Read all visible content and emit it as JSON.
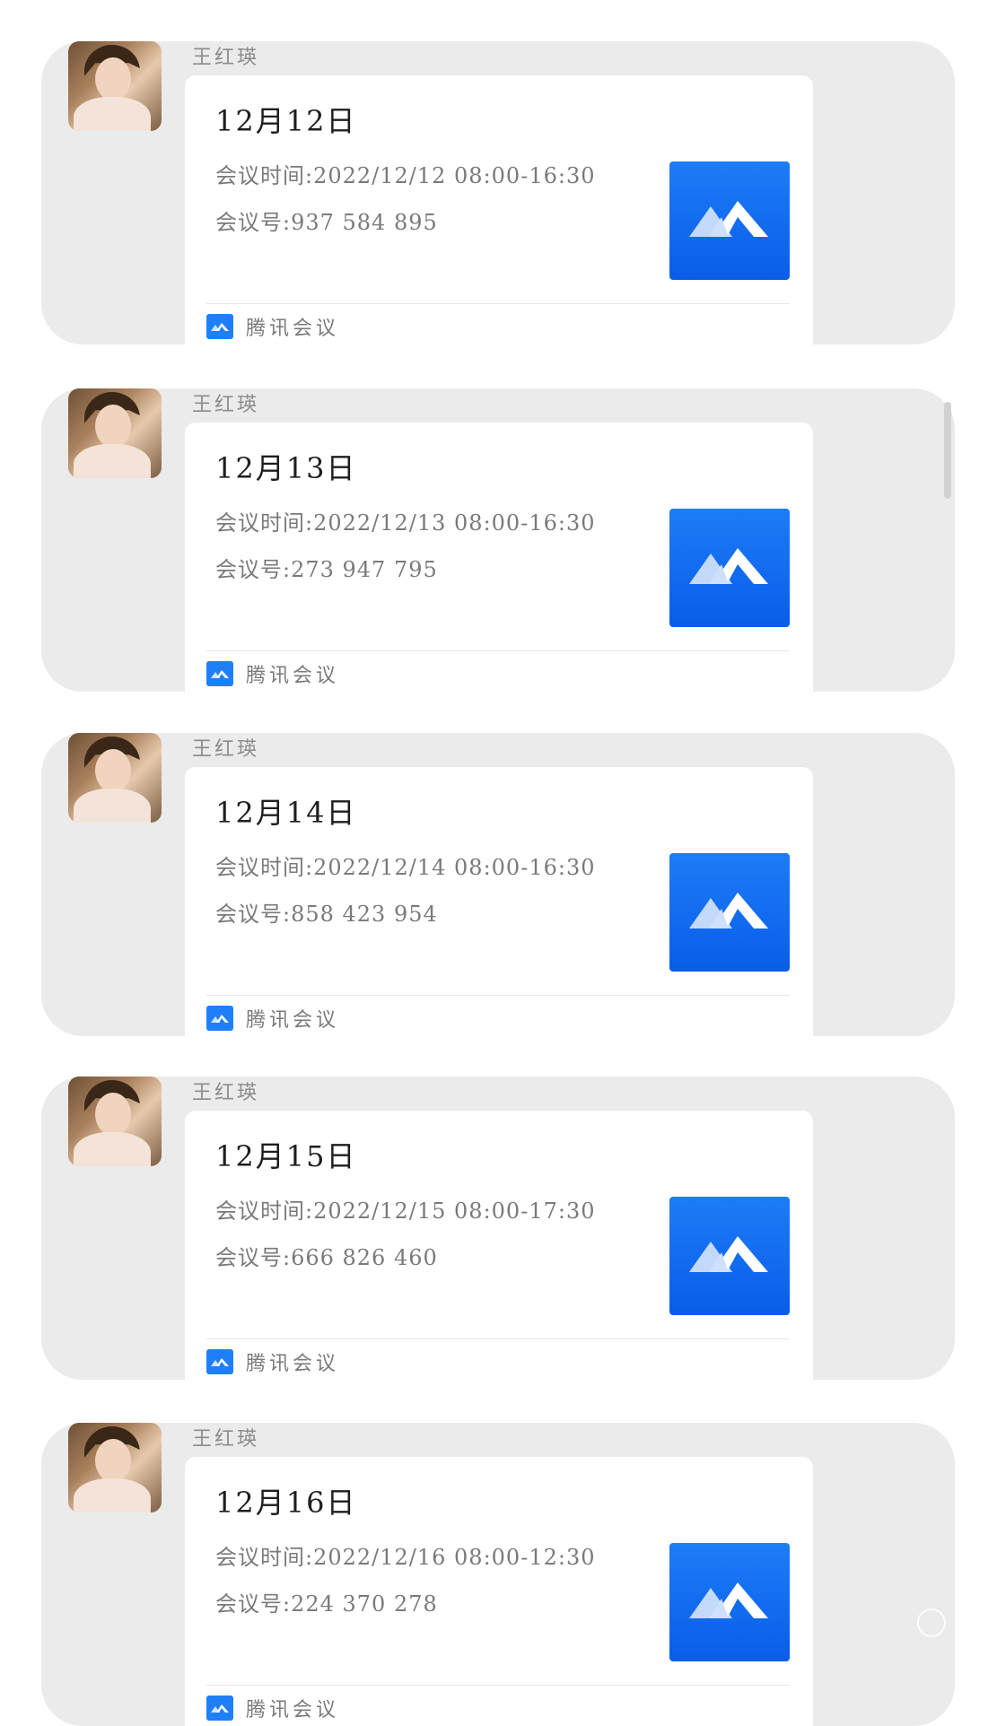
{
  "messages": [
    {
      "sender": "王红瑛",
      "date": "12月12日",
      "time_line": "会议时间:2022/12/12 08:00-16:30",
      "id_line": "会议号:937 584 895",
      "footer": "腾讯会议"
    },
    {
      "sender": "王红瑛",
      "date": "12月13日",
      "time_line": "会议时间:2022/12/13 08:00-16:30",
      "id_line": "会议号:273 947 795",
      "footer": "腾讯会议"
    },
    {
      "sender": "王红瑛",
      "date": "12月14日",
      "time_line": "会议时间:2022/12/14 08:00-16:30",
      "id_line": "会议号:858 423 954",
      "footer": "腾讯会议"
    },
    {
      "sender": "王红瑛",
      "date": "12月15日",
      "time_line": "会议时间:2022/12/15 08:00-17:30",
      "id_line": "会议号:666 826 460",
      "footer": "腾讯会议"
    },
    {
      "sender": "王红瑛",
      "date": "12月16日",
      "time_line": "会议时间:2022/12/16 08:00-12:30",
      "id_line": "会议号:224 370 278",
      "footer": "腾讯会议"
    }
  ],
  "icons": {
    "app_tile": "tencent-meeting-logo-icon",
    "footer": "tencent-meeting-small-icon",
    "watermark": "meitu-watermark-icon"
  },
  "colors": {
    "bubble_background": "#ebebeb",
    "card_background": "#ffffff",
    "brand_blue": "#1d7cf8",
    "secondary_text": "#7a7a7a"
  }
}
